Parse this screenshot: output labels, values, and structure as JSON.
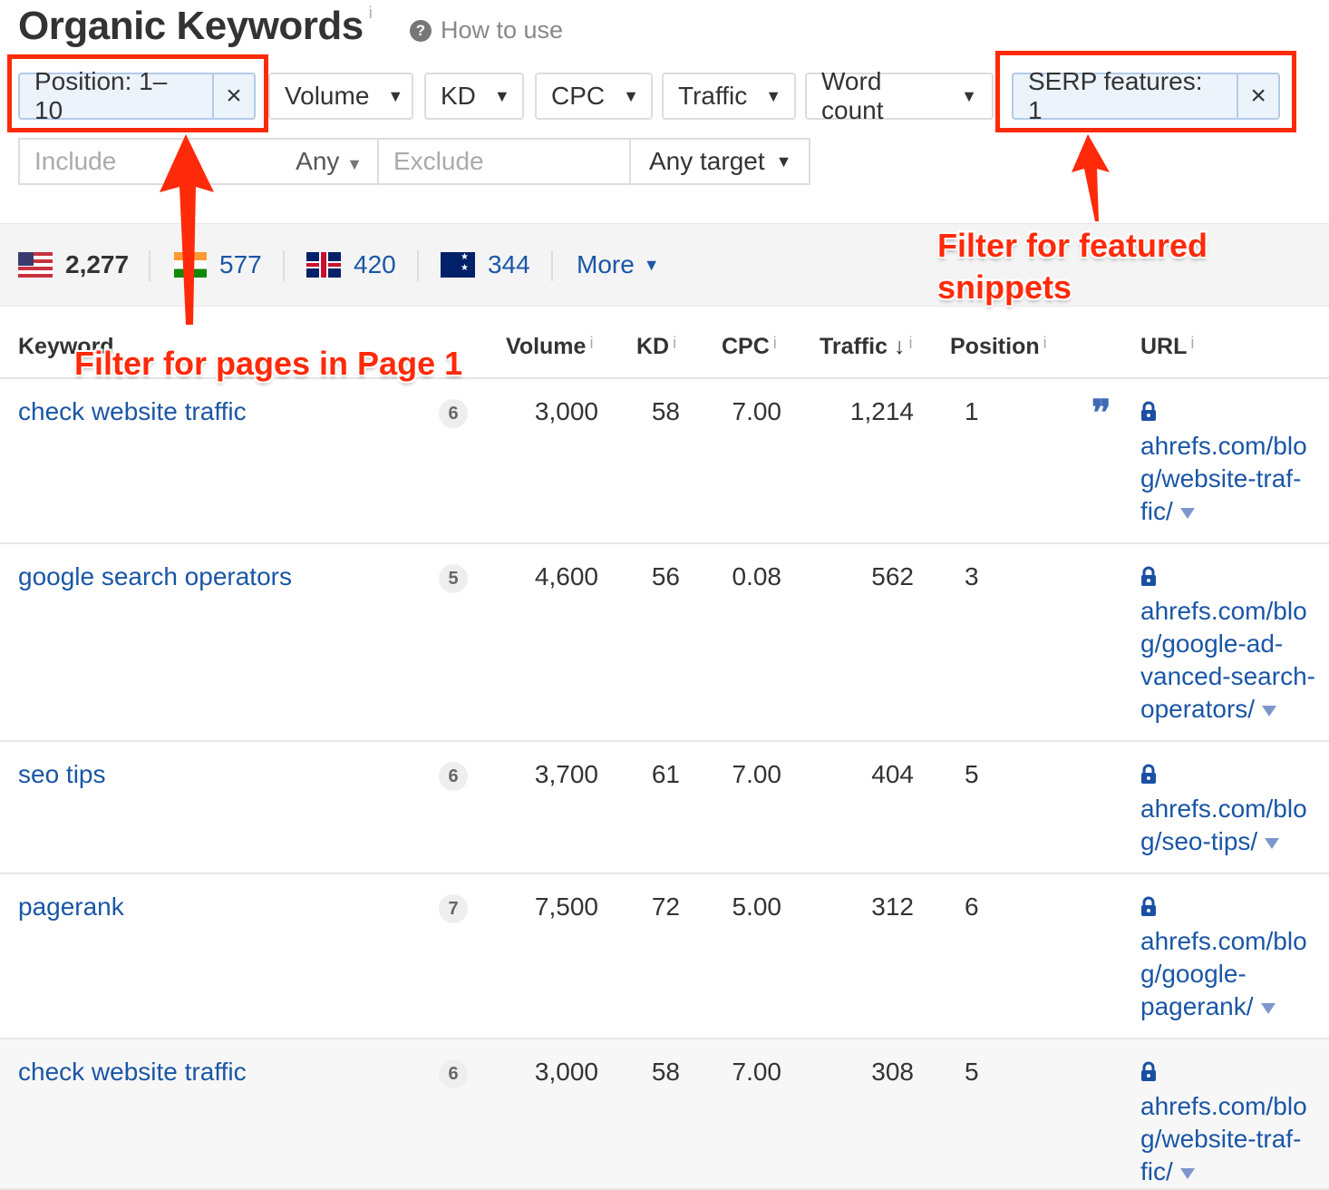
{
  "header": {
    "title": "Organic Keywords",
    "info": "i",
    "how_to_use": "How to use"
  },
  "filters": {
    "position": "Position: 1–10",
    "volume": "Volume",
    "kd": "KD",
    "cpc": "CPC",
    "traffic": "Traffic",
    "word_count": "Word count",
    "serp": "SERP features: 1",
    "include_placeholder": "Include",
    "any": "Any",
    "exclude_placeholder": "Exclude",
    "any_target": "Any target"
  },
  "countries": [
    {
      "flag": "us",
      "count": "2,277"
    },
    {
      "flag": "in",
      "count": "577"
    },
    {
      "flag": "gb",
      "count": "420"
    },
    {
      "flag": "au",
      "count": "344"
    }
  ],
  "more": "More",
  "columns": {
    "keyword": "Keyword",
    "volume": "Volume",
    "kd": "KD",
    "cpc": "CPC",
    "traffic": "Traffic",
    "position": "Position",
    "url": "URL",
    "info": "i"
  },
  "rows": [
    {
      "keyword": "check website traffic",
      "sf": "6",
      "volume": "3,000",
      "kd": "58",
      "cpc": "7.00",
      "traffic": "1,214",
      "position": "1",
      "snippet": true,
      "url_lines": [
        "ahrefs.com/blo",
        "g/website-traf-",
        "fic/"
      ]
    },
    {
      "keyword": "google search operators",
      "sf": "5",
      "volume": "4,600",
      "kd": "56",
      "cpc": "0.08",
      "traffic": "562",
      "position": "3",
      "snippet": false,
      "url_lines": [
        "ahrefs.com/blo",
        "g/google-ad-",
        "vanced-search-",
        "operators/"
      ]
    },
    {
      "keyword": "seo tips",
      "sf": "6",
      "volume": "3,700",
      "kd": "61",
      "cpc": "7.00",
      "traffic": "404",
      "position": "5",
      "snippet": false,
      "url_lines": [
        "ahrefs.com/blo",
        "g/seo-tips/"
      ]
    },
    {
      "keyword": "pagerank",
      "sf": "7",
      "volume": "7,500",
      "kd": "72",
      "cpc": "5.00",
      "traffic": "312",
      "position": "6",
      "snippet": false,
      "url_lines": [
        "ahrefs.com/blo",
        "g/google-",
        "pagerank/"
      ]
    },
    {
      "keyword": "check website traffic",
      "sf": "6",
      "volume": "3,000",
      "kd": "58",
      "cpc": "7.00",
      "traffic": "308",
      "position": "5",
      "snippet": false,
      "url_lines": [
        "ahrefs.com/blo",
        "g/website-traf-",
        "fic/"
      ]
    }
  ],
  "annotations": {
    "page1": "Filter for pages in Page 1",
    "featured_line1": "Filter for featured",
    "featured_line2": "snippets"
  },
  "colors": {
    "link": "#1a56a6",
    "annotation": "#ff2a0a",
    "active_filter": "#edf3fb"
  }
}
